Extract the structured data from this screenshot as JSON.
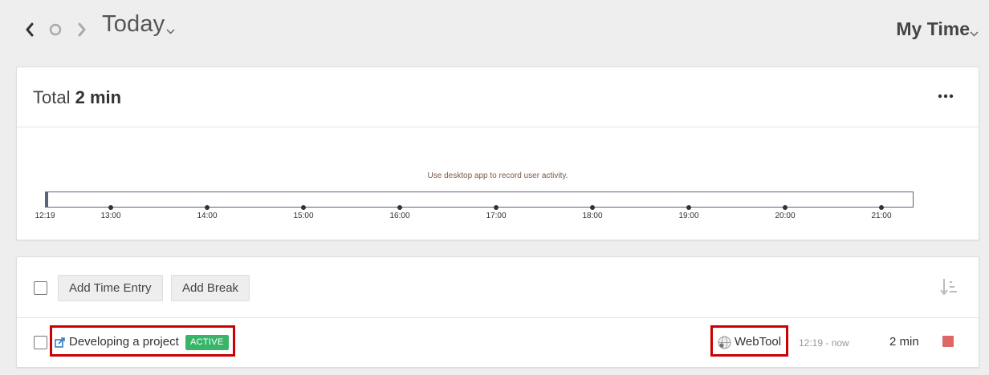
{
  "header": {
    "date_label": "Today",
    "view_label": "My Time"
  },
  "summary": {
    "total_label": "Total",
    "total_value": "2 min",
    "hint": "Use desktop app to record user activity.",
    "timeline_ticks": [
      "12:19",
      "13:00",
      "14:00",
      "15:00",
      "16:00",
      "17:00",
      "18:00",
      "19:00",
      "20:00",
      "21:00"
    ]
  },
  "toolbar": {
    "add_time_entry": "Add Time Entry",
    "add_break": "Add Break"
  },
  "entries": [
    {
      "task": "Developing a project",
      "status": "ACTIVE",
      "app": "WebTool",
      "time_range": "12:19 - now",
      "duration": "2 min"
    }
  ],
  "colors": {
    "background": "#eeeeee",
    "active_badge": "#39b56a",
    "stop_button": "#e06666",
    "highlight": "#cc0000",
    "link_icon": "#2f7fc8"
  },
  "icons": {
    "prev": "chevron-left-icon",
    "today": "circle-icon",
    "next": "chevron-right-icon",
    "more": "ellipsis-icon",
    "sort": "sort-descending-icon",
    "external": "external-link-icon",
    "app": "globe-icon",
    "stop": "stop-icon"
  }
}
